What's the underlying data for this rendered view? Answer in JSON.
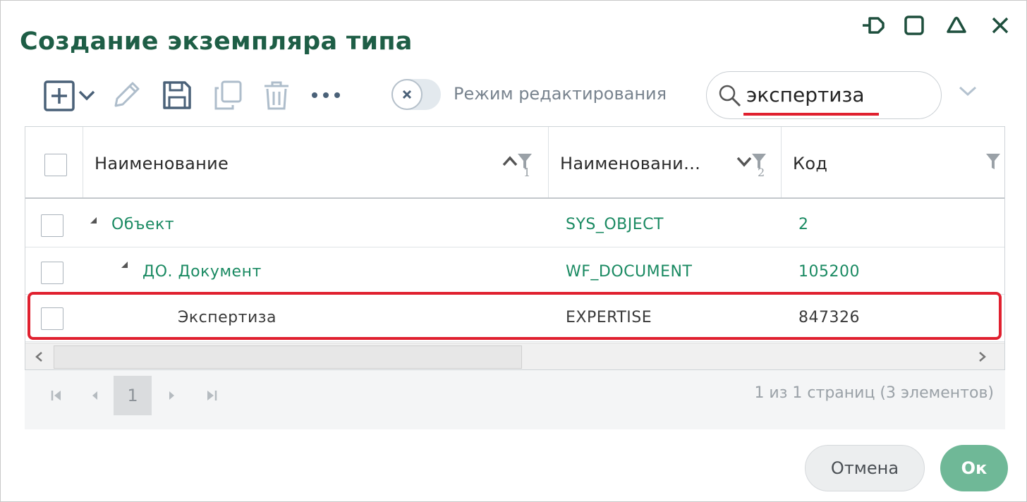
{
  "dialog": {
    "title": "Создание экземпляра типа",
    "window_buttons": [
      "pin-icon",
      "maximize-icon",
      "collapse-icon",
      "close-icon"
    ]
  },
  "toolbar": {
    "icons": [
      "add-icon",
      "chevron-down-icon",
      "edit-icon",
      "save-icon",
      "copy-icon",
      "delete-icon",
      "more-icon"
    ],
    "edit_mode_label": "Режим редактирования",
    "edit_mode_on": false
  },
  "search": {
    "value": "экспертиза"
  },
  "grid": {
    "columns": [
      {
        "label": "Наименование",
        "sort": "asc",
        "sort_order": "1"
      },
      {
        "label": "Наименовани…",
        "sort": "desc",
        "sort_order": "2"
      },
      {
        "label": "Код",
        "sort": "",
        "sort_order": ""
      }
    ],
    "rows": [
      {
        "name": "Объект",
        "system_name": "SYS_OBJECT",
        "code": "2",
        "level": 0,
        "expanded": true,
        "highlighted": false
      },
      {
        "name": "ДО. Документ",
        "system_name": "WF_DOCUMENT",
        "code": "105200",
        "level": 1,
        "expanded": true,
        "highlighted": false
      },
      {
        "name": "Экспертиза",
        "system_name": "EXPERTISE",
        "code": "847326",
        "level": 2,
        "expanded": false,
        "highlighted": true
      }
    ]
  },
  "pager": {
    "current_page": "1",
    "info": "1 из 1 страниц (3 элементов)"
  },
  "buttons": {
    "cancel": "Отмена",
    "ok": "Ок"
  },
  "colors": {
    "title": "#1e5e46",
    "link_green": "#1a8a62",
    "highlight_red": "#e0202f",
    "ok_button": "#6fb897"
  }
}
